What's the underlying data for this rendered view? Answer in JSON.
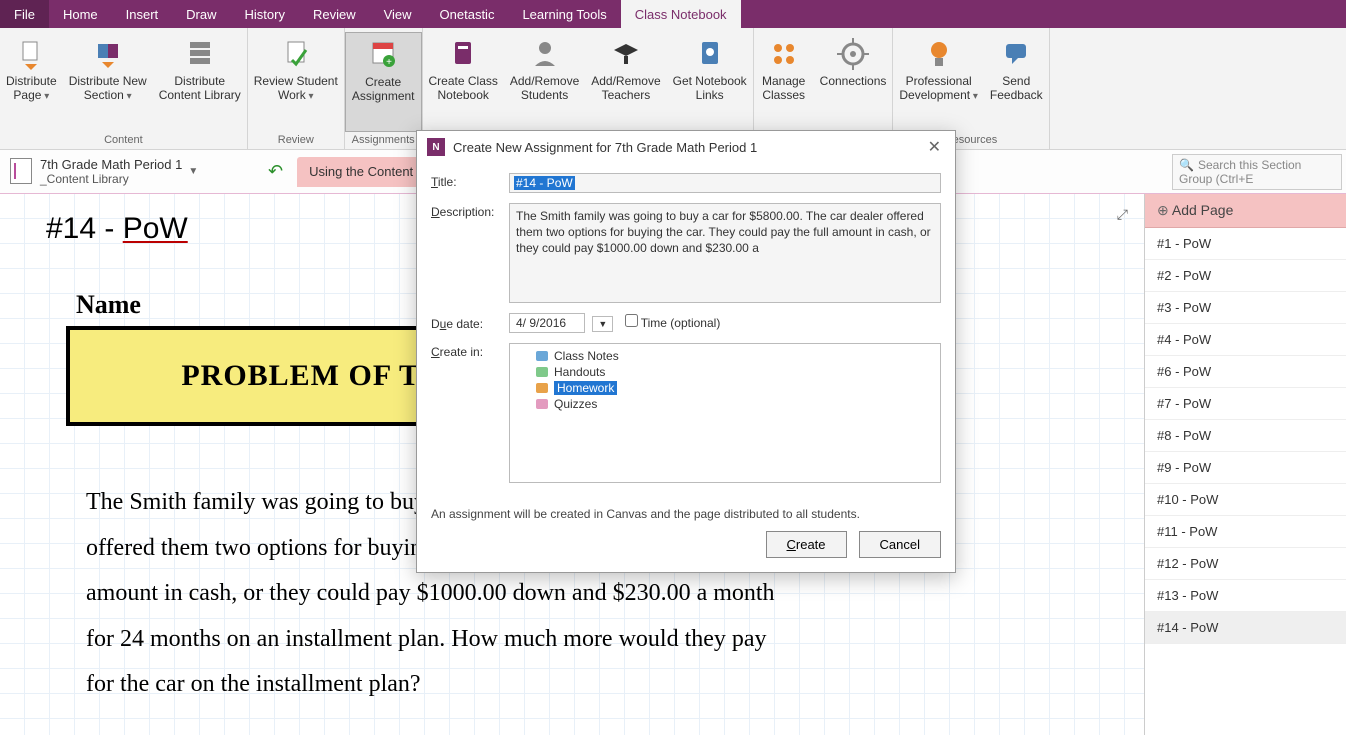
{
  "tabs": {
    "items": [
      "File",
      "Home",
      "Insert",
      "Draw",
      "History",
      "Review",
      "View",
      "Onetastic",
      "Learning Tools",
      "Class Notebook"
    ],
    "active_index": 9
  },
  "ribbon": {
    "groups": [
      {
        "label": "Content",
        "buttons": [
          {
            "label": "Distribute\nPage",
            "icon": "distribute-page-icon",
            "drop": true
          },
          {
            "label": "Distribute New\nSection",
            "icon": "distribute-section-icon",
            "drop": true
          },
          {
            "label": "Distribute\nContent Library",
            "icon": "distribute-library-icon"
          }
        ]
      },
      {
        "label": "Review",
        "buttons": [
          {
            "label": "Review Student\nWork",
            "icon": "review-work-icon",
            "drop": true
          }
        ]
      },
      {
        "label": "Assignments",
        "buttons": [
          {
            "label": "Create\nAssignment",
            "icon": "create-assignment-icon",
            "active": true
          }
        ]
      },
      {
        "label": "",
        "buttons": [
          {
            "label": "Create Class\nNotebook",
            "icon": "create-class-notebook-icon"
          },
          {
            "label": "Add/Remove\nStudents",
            "icon": "students-icon"
          },
          {
            "label": "Add/Remove\nTeachers",
            "icon": "teachers-icon"
          },
          {
            "label": "Get Notebook\nLinks",
            "icon": "links-icon"
          }
        ]
      },
      {
        "label": "",
        "buttons": [
          {
            "label": "Manage\nClasses",
            "icon": "manage-classes-icon"
          },
          {
            "label": "Connections",
            "icon": "connections-icon"
          }
        ]
      },
      {
        "label": "Resources",
        "buttons": [
          {
            "label": "Professional\nDevelopment",
            "icon": "prof-dev-icon",
            "drop": true
          },
          {
            "label": "Send\nFeedback",
            "icon": "feedback-icon"
          }
        ]
      }
    ]
  },
  "nav": {
    "notebook_title": "7th Grade Math Period 1",
    "notebook_sub": "_Content Library",
    "section_tab": "Using the Content Library",
    "search_placeholder": "Search this Section Group (Ctrl+E"
  },
  "page": {
    "title_prefix": "#14 - ",
    "title_pow": "PoW",
    "name_label": "Name",
    "pow_box": "PROBLEM OF THE WEEK",
    "body": "The Smith family was going to buy a car for $5800.00. The car dealer offered them two options for buying the car. They could pay the full amount in cash, or they could pay $1000.00 down and $230.00 a month for 24 months on an installment plan. How much more would they pay for the car on the installment plan?"
  },
  "pages_panel": {
    "add_label": "Add Page",
    "items": [
      "#1 - PoW",
      "#2 - PoW",
      "#3 - PoW",
      "#4 - PoW",
      "#6 - PoW",
      "#7 - PoW",
      "#8 - PoW",
      "#9 - PoW",
      "#10 - PoW",
      "#11 - PoW",
      "#12 - PoW",
      "#13 - PoW",
      "#14 - PoW"
    ],
    "selected_index": 12
  },
  "dialog": {
    "title": "Create New Assignment for 7th Grade Math Period 1",
    "labels": {
      "title": "Title:",
      "description": "Description:",
      "due": "Due date:",
      "create_in": "Create in:",
      "time": "Time (optional)"
    },
    "title_value": "#14 - PoW",
    "description": "The Smith family was going to buy a car for $5800.00. The car dealer offered them two options for buying the car. They could pay the full amount in cash, or they could pay $1000.00 down and $230.00 a",
    "due_date": "4/  9/2016",
    "tree": [
      {
        "label": "Class Notes",
        "color": "#6aa7d8"
      },
      {
        "label": "Handouts",
        "color": "#7fc98a"
      },
      {
        "label": "Homework",
        "color": "#e8a24a",
        "selected": true
      },
      {
        "label": "Quizzes",
        "color": "#e39bbf"
      }
    ],
    "note": "An assignment will be created in Canvas and the page distributed to all students.",
    "create_btn": "Create",
    "cancel_btn": "Cancel"
  },
  "icons": {
    "colors": {
      "purple": "#7a2d6a",
      "orange": "#e8872e",
      "blue": "#4a7fb5",
      "gray": "#888",
      "green": "#3aa23a"
    }
  }
}
